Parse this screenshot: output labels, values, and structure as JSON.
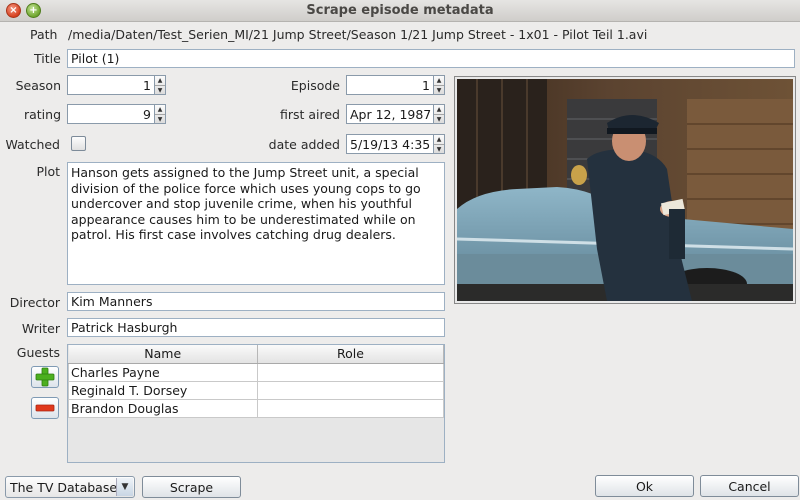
{
  "window": {
    "title": "Scrape episode metadata"
  },
  "labels": {
    "path": "Path",
    "title": "Title",
    "season": "Season",
    "episode": "Episode",
    "rating": "rating",
    "first_aired": "first aired",
    "watched": "Watched",
    "date_added": "date added",
    "plot": "Plot",
    "director": "Director",
    "writer": "Writer",
    "guests": "Guests"
  },
  "values": {
    "path": "/media/Daten/Test_Serien_MI/21 Jump Street/Season 1/21 Jump Street - 1x01 - Pilot Teil 1.avi",
    "title": "Pilot (1)",
    "season": "1",
    "episode": "1",
    "rating": "9",
    "first_aired": "Apr 12, 1987",
    "date_added": "5/19/13 4:35",
    "watched": false,
    "plot": "Hanson gets assigned to the Jump Street unit, a special division of the police force which uses young cops to go undercover and stop juvenile crime, when his youthful appearance causes him to be underestimated while on patrol. His first case involves catching drug dealers.",
    "director": "Kim Manners",
    "writer": "Patrick Hasburgh"
  },
  "guests": {
    "columns": [
      "Name",
      "Role"
    ],
    "rows": [
      {
        "name": "Charles Payne",
        "role": ""
      },
      {
        "name": "Reginald T. Dorsey",
        "role": ""
      },
      {
        "name": "Brandon Douglas",
        "role": ""
      }
    ]
  },
  "footer": {
    "scraper_selected": "The TV Database",
    "scrape_label": "Scrape",
    "ok_label": "Ok",
    "cancel_label": "Cancel"
  },
  "icons": {
    "add": "plus-icon",
    "remove": "minus-icon",
    "add_color": "#4caf1f",
    "remove_color": "#e0381c"
  }
}
